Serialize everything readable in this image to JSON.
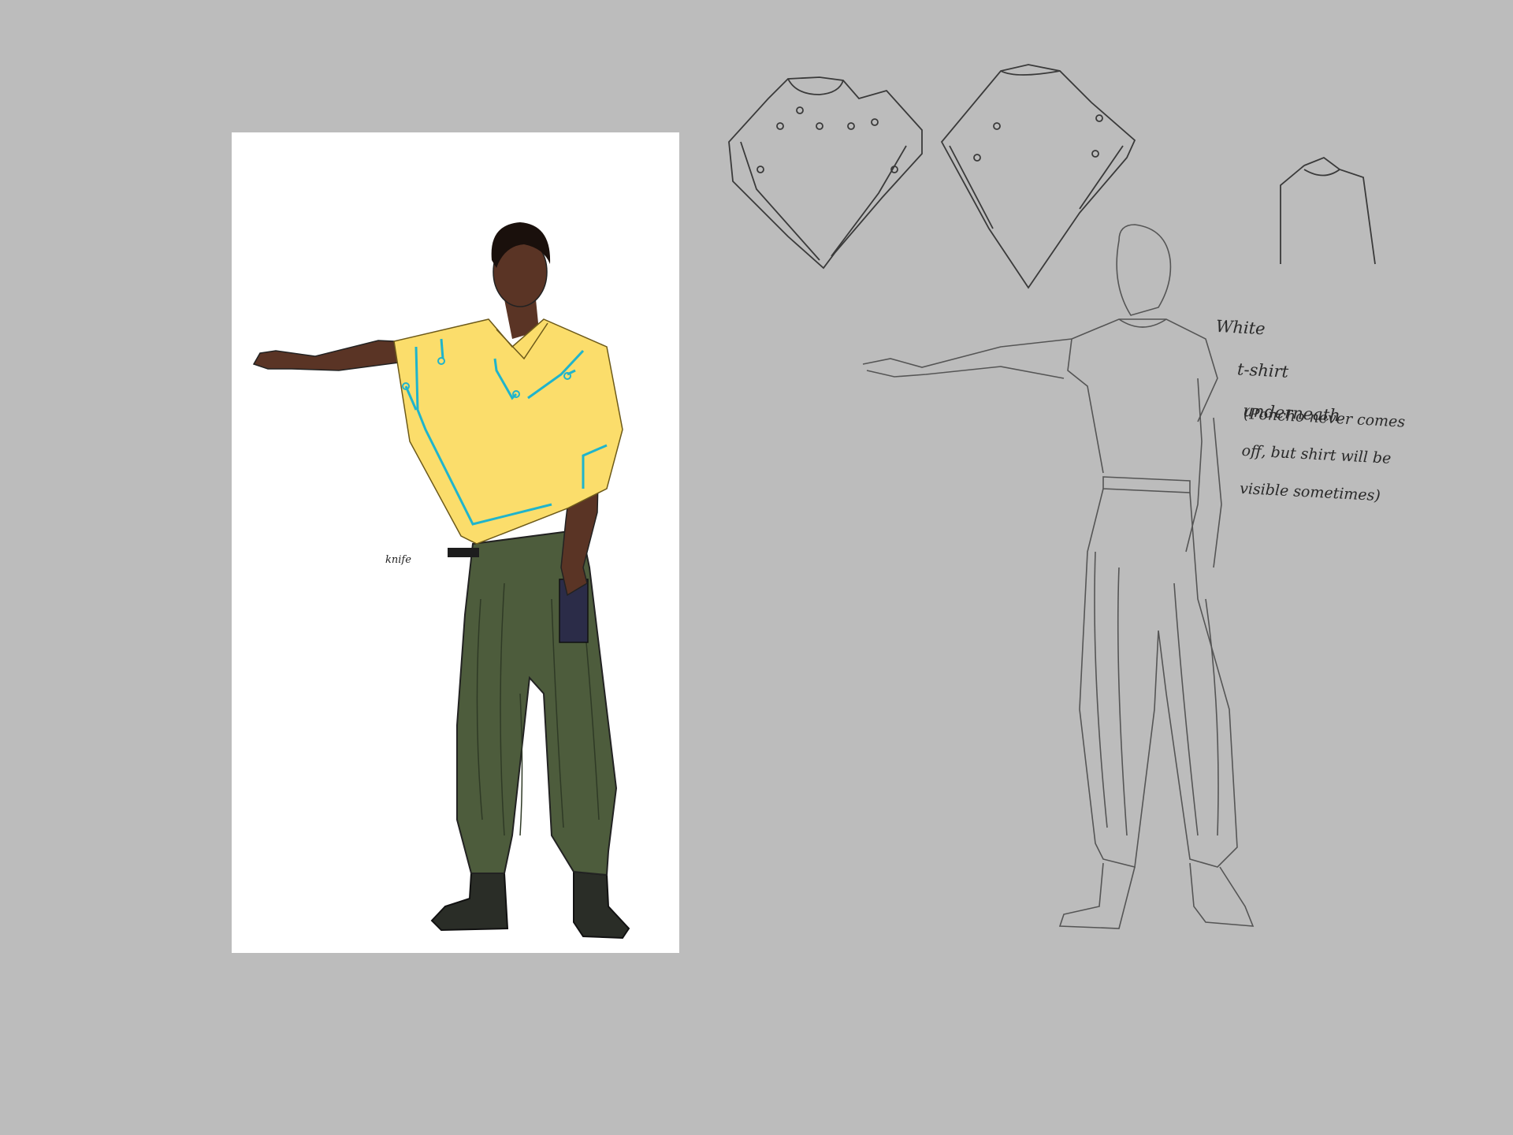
{
  "annotations": {
    "knife_label": "knife",
    "tshirt_note": [
      "White",
      "t-shirt",
      "underneath"
    ],
    "poncho_note": [
      "(Poncho never comes",
      "off, but shirt will be",
      "visible sometimes)"
    ]
  },
  "colors": {
    "background": "#bcbcbc",
    "panel": "#ffffff",
    "poncho": "#fbdd6b",
    "circuit": "#1fb4cc",
    "skin": "#5a3425",
    "pants": "#4d5c3c",
    "boots": "#2a2d27",
    "sketch_line": "#3a3a3a"
  }
}
